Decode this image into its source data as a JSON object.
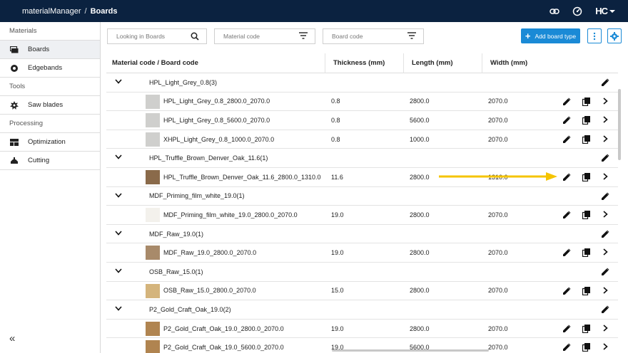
{
  "topbar": {
    "app_name": "materialManager",
    "separator": "/",
    "current": "Boards",
    "logo_text": "HC",
    "icons": [
      "link-icon",
      "speedometer-icon",
      "account-menu-icon"
    ]
  },
  "sidebar": {
    "sections": [
      {
        "label": "Materials",
        "items": [
          {
            "label": "Boards",
            "icon": "boards-icon",
            "active": true
          },
          {
            "label": "Edgebands",
            "icon": "edgeband-icon"
          }
        ]
      },
      {
        "label": "Tools",
        "items": [
          {
            "label": "Saw blades",
            "icon": "saw-blade-icon"
          }
        ]
      },
      {
        "label": "Processing",
        "items": [
          {
            "label": "Optimization",
            "icon": "optimization-icon"
          },
          {
            "label": "Cutting",
            "icon": "cutting-icon"
          }
        ]
      }
    ],
    "collapse_label": "«"
  },
  "toolbar": {
    "search_placeholder": "Looking in Boards",
    "material_filter_placeholder": "Material code",
    "board_filter_placeholder": "Board code",
    "add_label": "Add board type"
  },
  "table": {
    "headers": [
      "Material code / Board code",
      "Thickness (mm)",
      "Length (mm)",
      "Width (mm)"
    ],
    "groups": [
      {
        "name": "HPL_Light_Grey_0.8(3)",
        "rows": [
          {
            "name": "HPL_Light_Grey_0.8_2800.0_2070.0",
            "thickness": "0.8",
            "length": "2800.0",
            "width": "2070.0",
            "thumb": "#cfcfcd"
          },
          {
            "name": "HPL_Light_Grey_0.8_5600.0_2070.0",
            "thickness": "0.8",
            "length": "5600.0",
            "width": "2070.0",
            "thumb": "#cfcfcd"
          },
          {
            "name": "XHPL_Light_Grey_0.8_1000.0_2070.0",
            "thickness": "0.8",
            "length": "1000.0",
            "width": "2070.0",
            "thumb": "#cfcfcd"
          }
        ]
      },
      {
        "name": "HPL_Truffle_Brown_Denver_Oak_11.6(1)",
        "rows": [
          {
            "name": "HPL_Truffle_Brown_Denver_Oak_11.6_2800.0_1310.0",
            "thickness": "11.6",
            "length": "2800.0",
            "width": "1310.0",
            "thumb": "#8a6a4a"
          }
        ]
      },
      {
        "name": "MDF_Priming_film_white_19.0(1)",
        "rows": [
          {
            "name": "MDF_Priming_film_white_19.0_2800.0_2070.0",
            "thickness": "19.0",
            "length": "2800.0",
            "width": "2070.0",
            "thumb": "#f3f1ec"
          }
        ]
      },
      {
        "name": "MDF_Raw_19.0(1)",
        "rows": [
          {
            "name": "MDF_Raw_19.0_2800.0_2070.0",
            "thickness": "19.0",
            "length": "2800.0",
            "width": "2070.0",
            "thumb": "#a88a6a"
          }
        ]
      },
      {
        "name": "OSB_Raw_15.0(1)",
        "rows": [
          {
            "name": "OSB_Raw_15.0_2800.0_2070.0",
            "thickness": "15.0",
            "length": "2800.0",
            "width": "2070.0",
            "thumb": "#d4b47c"
          }
        ]
      },
      {
        "name": "P2_Gold_Craft_Oak_19.0(2)",
        "rows": [
          {
            "name": "P2_Gold_Craft_Oak_19.0_2800.0_2070.0",
            "thickness": "19.0",
            "length": "2800.0",
            "width": "2070.0",
            "thumb": "#b08450"
          },
          {
            "name": "P2_Gold_Craft_Oak_19.0_5600.0_2070.0",
            "thickness": "19.0",
            "length": "5600.0",
            "width": "2070.0",
            "thumb": "#b08450"
          }
        ]
      }
    ]
  },
  "colors": {
    "topbar": "#0b2240",
    "accent": "#1a8ad6",
    "annotation_arrow": "#f5c400"
  }
}
